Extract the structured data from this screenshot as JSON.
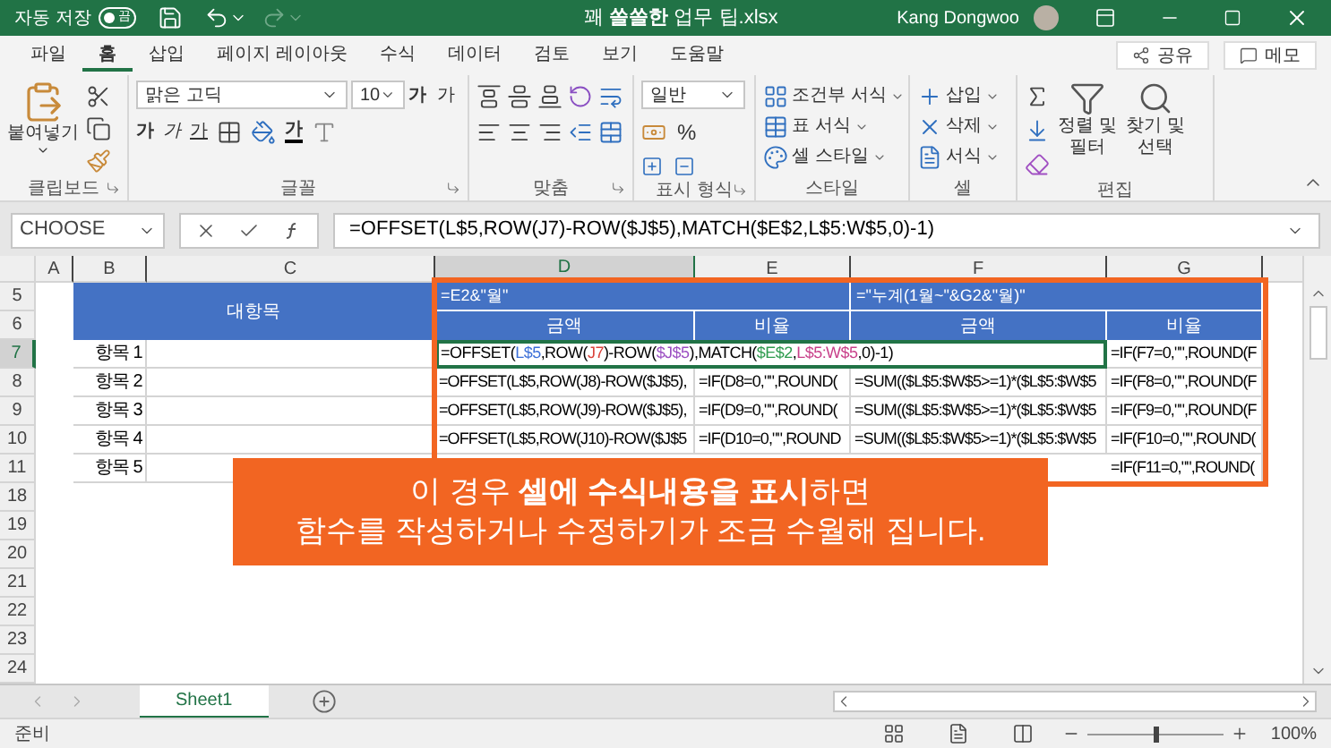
{
  "title_bar": {
    "autosave_label": "자동 저장",
    "autosave_on": false,
    "autosave_state": "끔",
    "title": "꽤 **쏠쏠한** 업무 팁.xlsx",
    "user": "Kang Dongwoo"
  },
  "ribbon_tabs": [
    {
      "label": "파일",
      "selected": false
    },
    {
      "label": "홈",
      "selected": true
    },
    {
      "label": "삽입",
      "selected": false
    },
    {
      "label": "페이지 레이아웃",
      "selected": false
    },
    {
      "label": "수식",
      "selected": false
    },
    {
      "label": "데이터",
      "selected": false
    },
    {
      "label": "검토",
      "selected": false
    },
    {
      "label": "보기",
      "selected": false
    },
    {
      "label": "도움말",
      "selected": false
    }
  ],
  "share_button": "공유",
  "comment_button": "메모",
  "ribbon": {
    "paste_label": "붙여넣기",
    "font_name": "맑은 고딕",
    "font_size": "10",
    "grow_font": "가",
    "shrink_font": "가",
    "bold": "가",
    "italic": "가",
    "underline": "가",
    "font_color": "가",
    "number_format": "일반",
    "percent": "%",
    "styles": [
      "조건부 서식",
      "표 서식",
      "셀 스타일"
    ],
    "cells": [
      "삽입",
      "삭제",
      "서식"
    ],
    "sort_filter": "정렬 및 필터",
    "find_select": "찾기 및 선택",
    "groups": [
      "클립보드",
      "글꼴",
      "맞춤",
      "표시 형식",
      "스타일",
      "셀",
      "편집"
    ]
  },
  "formula_bar": {
    "name_box": "CHOOSE",
    "formula": "=OFFSET(L$5,ROW(J7)-ROW($J$5),MATCH($E$2,L$5:W$5,0)-1)"
  },
  "sheet": {
    "columns": [
      {
        "label": "A",
        "selected": false
      },
      {
        "label": "B",
        "selected": false
      },
      {
        "label": "C",
        "selected": false
      },
      {
        "label": "D",
        "selected": true
      },
      {
        "label": "E",
        "selected": false
      },
      {
        "label": "F",
        "selected": false
      },
      {
        "label": "G",
        "selected": false
      }
    ],
    "rows": [
      {
        "label": "5",
        "selected": false
      },
      {
        "label": "6",
        "selected": false
      },
      {
        "label": "7",
        "selected": true
      },
      {
        "label": "8",
        "selected": false
      },
      {
        "label": "9",
        "selected": false
      },
      {
        "label": "10",
        "selected": false
      },
      {
        "label": "11",
        "selected": false
      },
      {
        "label": "18",
        "selected": false
      },
      {
        "label": "19",
        "selected": false
      },
      {
        "label": "20",
        "selected": false
      },
      {
        "label": "21",
        "selected": false
      },
      {
        "label": "22",
        "selected": false
      },
      {
        "label": "23",
        "selected": false
      },
      {
        "label": "24",
        "selected": false
      }
    ],
    "header": {
      "title": "대항목",
      "group_formulas": [
        "=E2&\"월\"",
        "=\"누계(1월~\"&G2&\"월)\""
      ],
      "subheaders": [
        "금액",
        "비율",
        "금액",
        "비율"
      ]
    },
    "items": [
      {
        "label": "항목 1",
        "kind": "editing",
        "formula_parts": [
          {
            "prefix": "=OFFSET(",
            "ref": "L$5",
            "color": "#3b6fd8"
          },
          {
            "prefix": ",ROW(",
            "ref": "J7",
            "color": "#d9433b"
          },
          {
            "prefix": ")-ROW(",
            "ref": "$J$5",
            "color": "#9b4fc2"
          },
          {
            "prefix": "),MATCH(",
            "ref": "$E$2",
            "color": "#2f9b4f"
          },
          {
            "prefix": ",",
            "ref": "L$5:W$5",
            "color": "#c8408a"
          }
        ],
        "formula_end": ",0)-1)",
        "cells": [
          "=IF(F7=0,\"\",ROUND(F"
        ]
      },
      {
        "label": "항목 2",
        "kind": "plain",
        "cells": [
          "=OFFSET(L$5,ROW(J8)-ROW($J$5),",
          "=IF(D8=0,\"\",ROUND(",
          "=SUM(($L$5:$W$5>=1)*($L$5:$W$5",
          "=IF(F8=0,\"\",ROUND(F"
        ]
      },
      {
        "label": "항목 3",
        "kind": "plain",
        "cells": [
          "=OFFSET(L$5,ROW(J9)-ROW($J$5),",
          "=IF(D9=0,\"\",ROUND(",
          "=SUM(($L$5:$W$5>=1)*($L$5:$W$5",
          "=IF(F9=0,\"\",ROUND(F"
        ]
      },
      {
        "label": "항목 4",
        "kind": "plain",
        "cells": [
          "=OFFSET(L$5,ROW(J10)-ROW($J$5",
          "=IF(D10=0,\"\",ROUND",
          "=SUM(($L$5:$W$5>=1)*($L$5:$W$5",
          "=IF(F10=0,\"\",ROUND("
        ]
      },
      {
        "label": "항목 5",
        "kind": "partial",
        "cells": [
          "=IF(F11=0,\"\",ROUND("
        ]
      }
    ]
  },
  "callout": {
    "lines": [
      "이 경우 **셀에 수식내용을 표시**하면",
      "함수를 작성하거나 수정하기가 조금 수월해 집니다."
    ]
  },
  "sheet_tabs": [
    {
      "label": "Sheet1",
      "selected": true
    }
  ],
  "status_bar": {
    "status": "준비",
    "zoom": "100%",
    "zoom_slider": {
      "level": 0.5
    }
  }
}
